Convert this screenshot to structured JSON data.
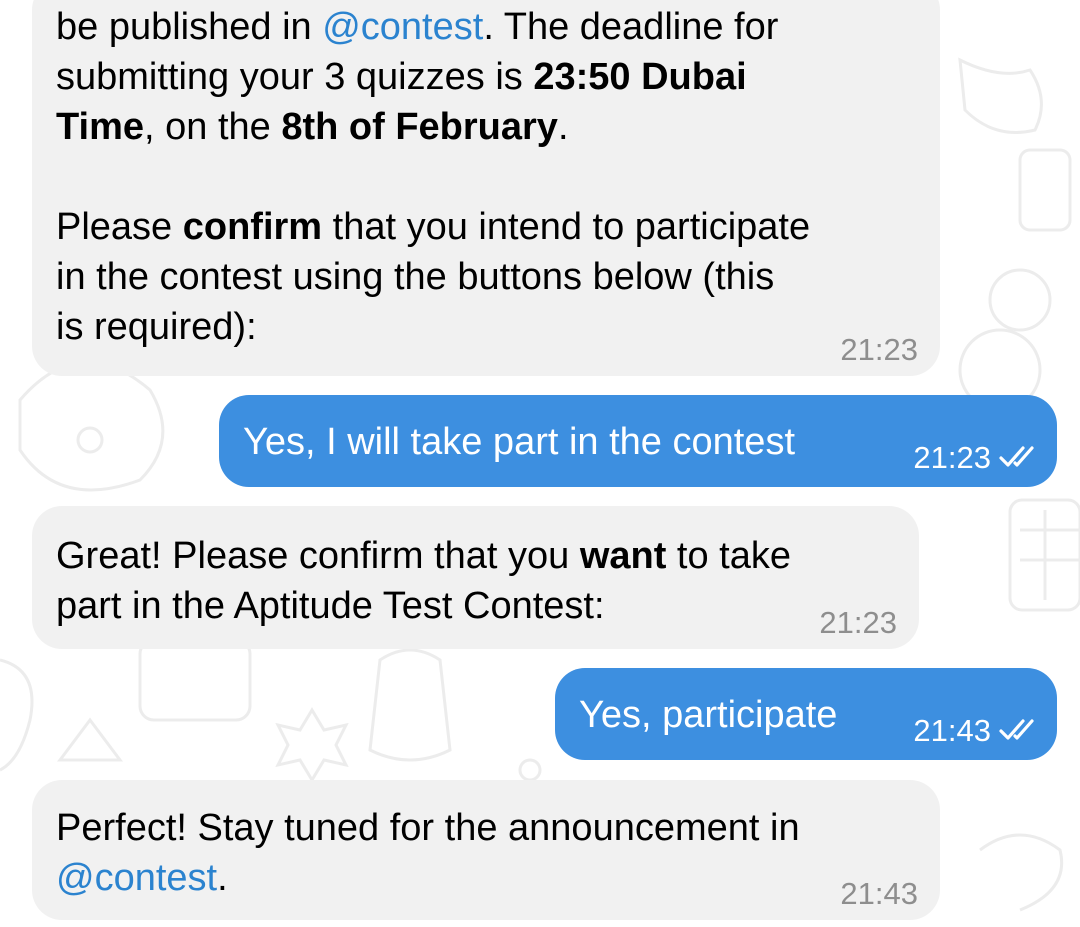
{
  "messages": [
    {
      "direction": "incoming",
      "segments": [
        "be published in ",
        "@contest",
        ". The deadline for",
        "submitting your 3 quizzes is ",
        "23:50 Dubai",
        "Time",
        ", on the ",
        "8th of February",
        ".",
        "Please ",
        "confirm",
        " that you intend to participate",
        "in the contest using the buttons below (this",
        "is required):"
      ],
      "time": "21:23"
    },
    {
      "direction": "outgoing",
      "text": "Yes, I will take part in the contest",
      "time": "21:23",
      "status": "double-check-read"
    },
    {
      "direction": "incoming",
      "segments": [
        "Great! Please confirm that you ",
        "want",
        " to take",
        "part in the Aptitude Test Contest:"
      ],
      "time": "21:23"
    },
    {
      "direction": "outgoing",
      "text": "Yes, participate",
      "time": "21:43",
      "status": "double-check-read"
    },
    {
      "direction": "incoming",
      "segments": [
        "Perfect! Stay tuned for the announcement in",
        "@contest",
        "."
      ],
      "time": "21:43"
    }
  ],
  "colors": {
    "incoming_bubble": "#f1f1f1",
    "outgoing_bubble": "#3d8fe0",
    "link": "#2b83cf",
    "timestamp_incoming": "#8e8e8e"
  },
  "icons": {
    "read_status": "double-check-icon"
  }
}
